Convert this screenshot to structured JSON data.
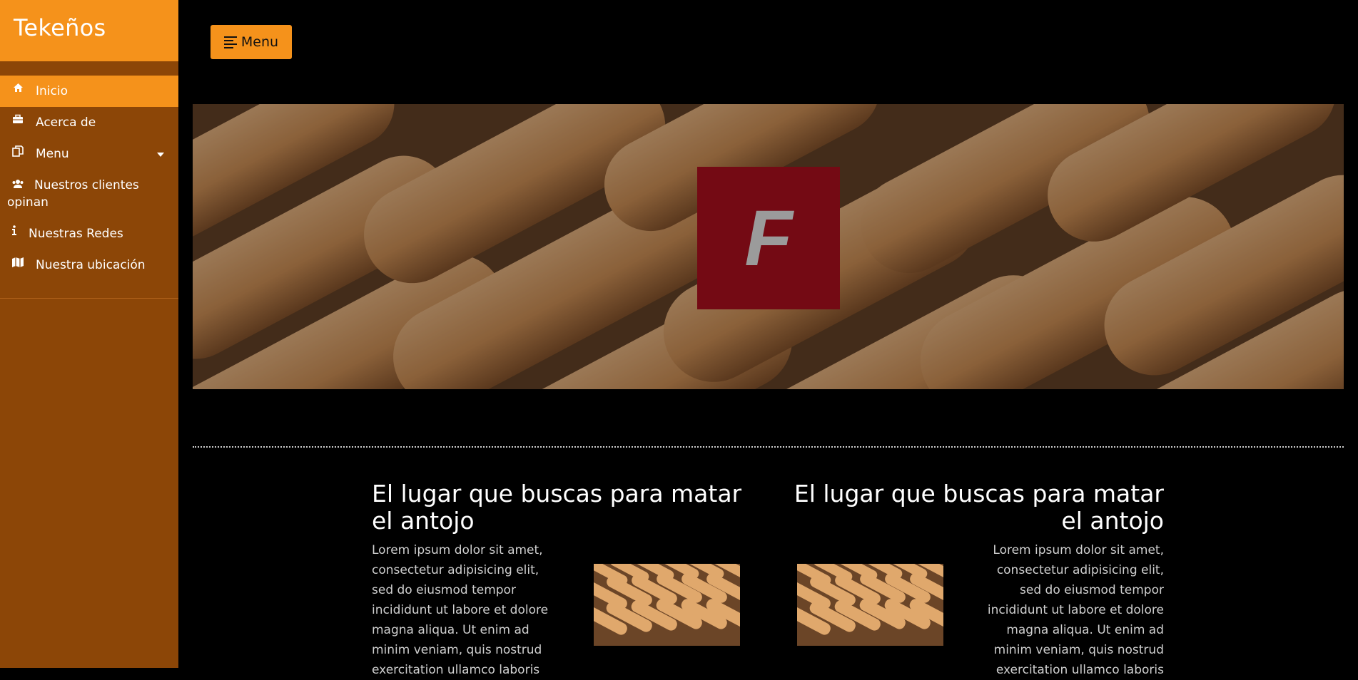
{
  "sidebar": {
    "brand": "Tekeños",
    "items": [
      {
        "label": "Inicio",
        "icon": "home-icon",
        "active": true
      },
      {
        "label": "Acerca de",
        "icon": "briefcase-icon"
      },
      {
        "label": "Menu",
        "icon": "copy-icon",
        "has_dropdown": true
      },
      {
        "label": "Nuestros clientes opinan",
        "icon": "users-icon"
      },
      {
        "label": "Nuestras Redes",
        "icon": "info-icon"
      },
      {
        "label": "Nuestra ubicación",
        "icon": "map-icon"
      }
    ]
  },
  "header": {
    "menu_button_label": "Menu",
    "menu_button_icon": "align-left-icon"
  },
  "hero": {
    "logo_letter": "F"
  },
  "features": [
    {
      "title": "El lugar que buscas para matar el antojo",
      "text": "Lorem ipsum dolor sit amet, consectetur adipisicing elit, sed do eiusmod tempor incididunt ut labore et dolore magna aliqua. Ut enim ad minim veniam, quis nostrud exercitation ullamco laboris"
    },
    {
      "title": "El lugar que buscas para matar el antojo",
      "text": "Lorem ipsum dolor sit amet, consectetur adipisicing elit, sed do eiusmod tempor incididunt ut labore et dolore magna aliqua. Ut enim ad minim veniam, quis nostrud exercitation ullamco laboris"
    }
  ],
  "colors": {
    "brand_orange": "#f5921b",
    "sidebar_brown": "#8c4607",
    "logo_red": "#740a14",
    "background": "#000000"
  }
}
